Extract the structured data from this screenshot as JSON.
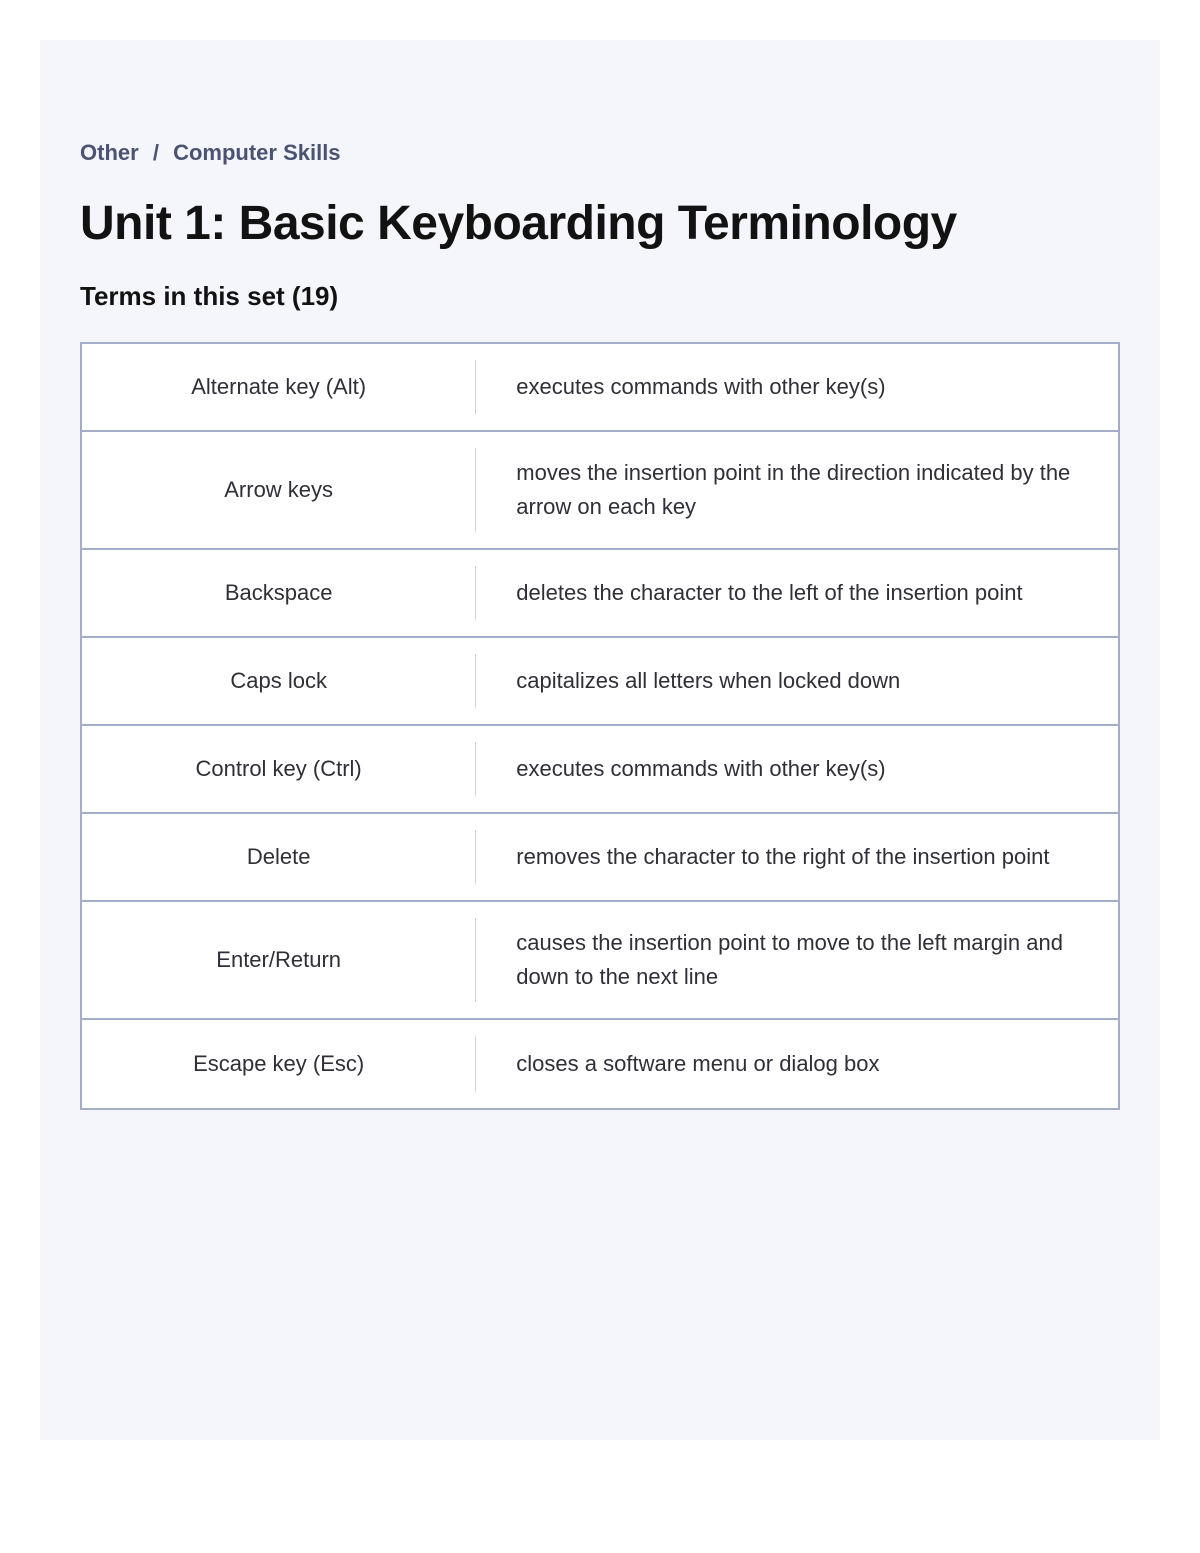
{
  "breadcrumb": {
    "item1": "Other",
    "sep": "/",
    "item2": "Computer Skills"
  },
  "title": "Unit 1: Basic Keyboarding Terminology",
  "subtitle": "Terms in this set (19)",
  "terms": [
    {
      "term": "Alternate key (Alt)",
      "definition": "executes commands with other key(s)"
    },
    {
      "term": "Arrow keys",
      "definition": "moves the insertion point in the direction indicated by the arrow on each key"
    },
    {
      "term": "Backspace",
      "definition": "deletes the character to the left of the insertion point"
    },
    {
      "term": "Caps lock",
      "definition": "capitalizes all letters when locked down"
    },
    {
      "term": "Control key (Ctrl)",
      "definition": "executes commands with other key(s)"
    },
    {
      "term": "Delete",
      "definition": "removes the character to the right of the insertion point"
    },
    {
      "term": "Enter/Return",
      "definition": "causes the insertion point to move to the left margin and down to the next line"
    },
    {
      "term": "Escape key (Esc)",
      "definition": "closes a software menu or dialog box"
    }
  ]
}
